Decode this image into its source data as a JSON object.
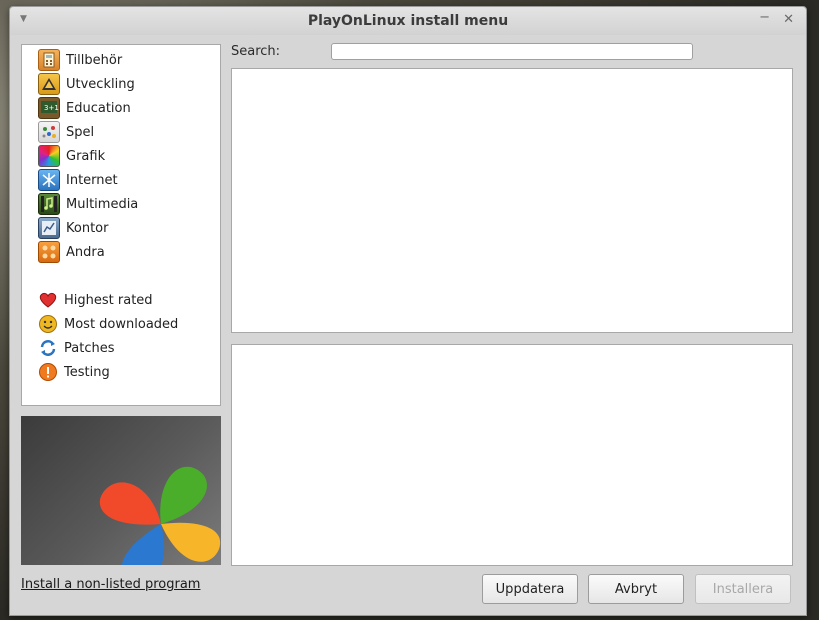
{
  "window": {
    "title": "PlayOnLinux install menu"
  },
  "search": {
    "label": "Search:",
    "value": "",
    "placeholder": ""
  },
  "categories": [
    {
      "label": "Tillbehör",
      "icon": "calculator-icon"
    },
    {
      "label": "Utveckling",
      "icon": "development-icon"
    },
    {
      "label": "Education",
      "icon": "chalkboard-icon"
    },
    {
      "label": "Spel",
      "icon": "gamepad-icon"
    },
    {
      "label": "Grafik",
      "icon": "color-palette-icon"
    },
    {
      "label": "Internet",
      "icon": "globe-icon"
    },
    {
      "label": "Multimedia",
      "icon": "music-note-icon"
    },
    {
      "label": "Kontor",
      "icon": "office-chart-icon"
    },
    {
      "label": "Andra",
      "icon": "misc-icon"
    }
  ],
  "filters": [
    {
      "label": "Highest rated",
      "icon": "heart-icon"
    },
    {
      "label": "Most downloaded",
      "icon": "smiley-icon"
    },
    {
      "label": "Patches",
      "icon": "refresh-icon"
    },
    {
      "label": "Testing",
      "icon": "warning-icon"
    }
  ],
  "link": {
    "label": "Install a non-listed program"
  },
  "buttons": {
    "update": "Uppdatera",
    "cancel": "Avbryt",
    "install": "Installera"
  },
  "colors": {
    "clover_red": "#f04a2a",
    "clover_green": "#4aae2a",
    "clover_yellow": "#f7b52a",
    "clover_blue": "#2a78d0"
  }
}
